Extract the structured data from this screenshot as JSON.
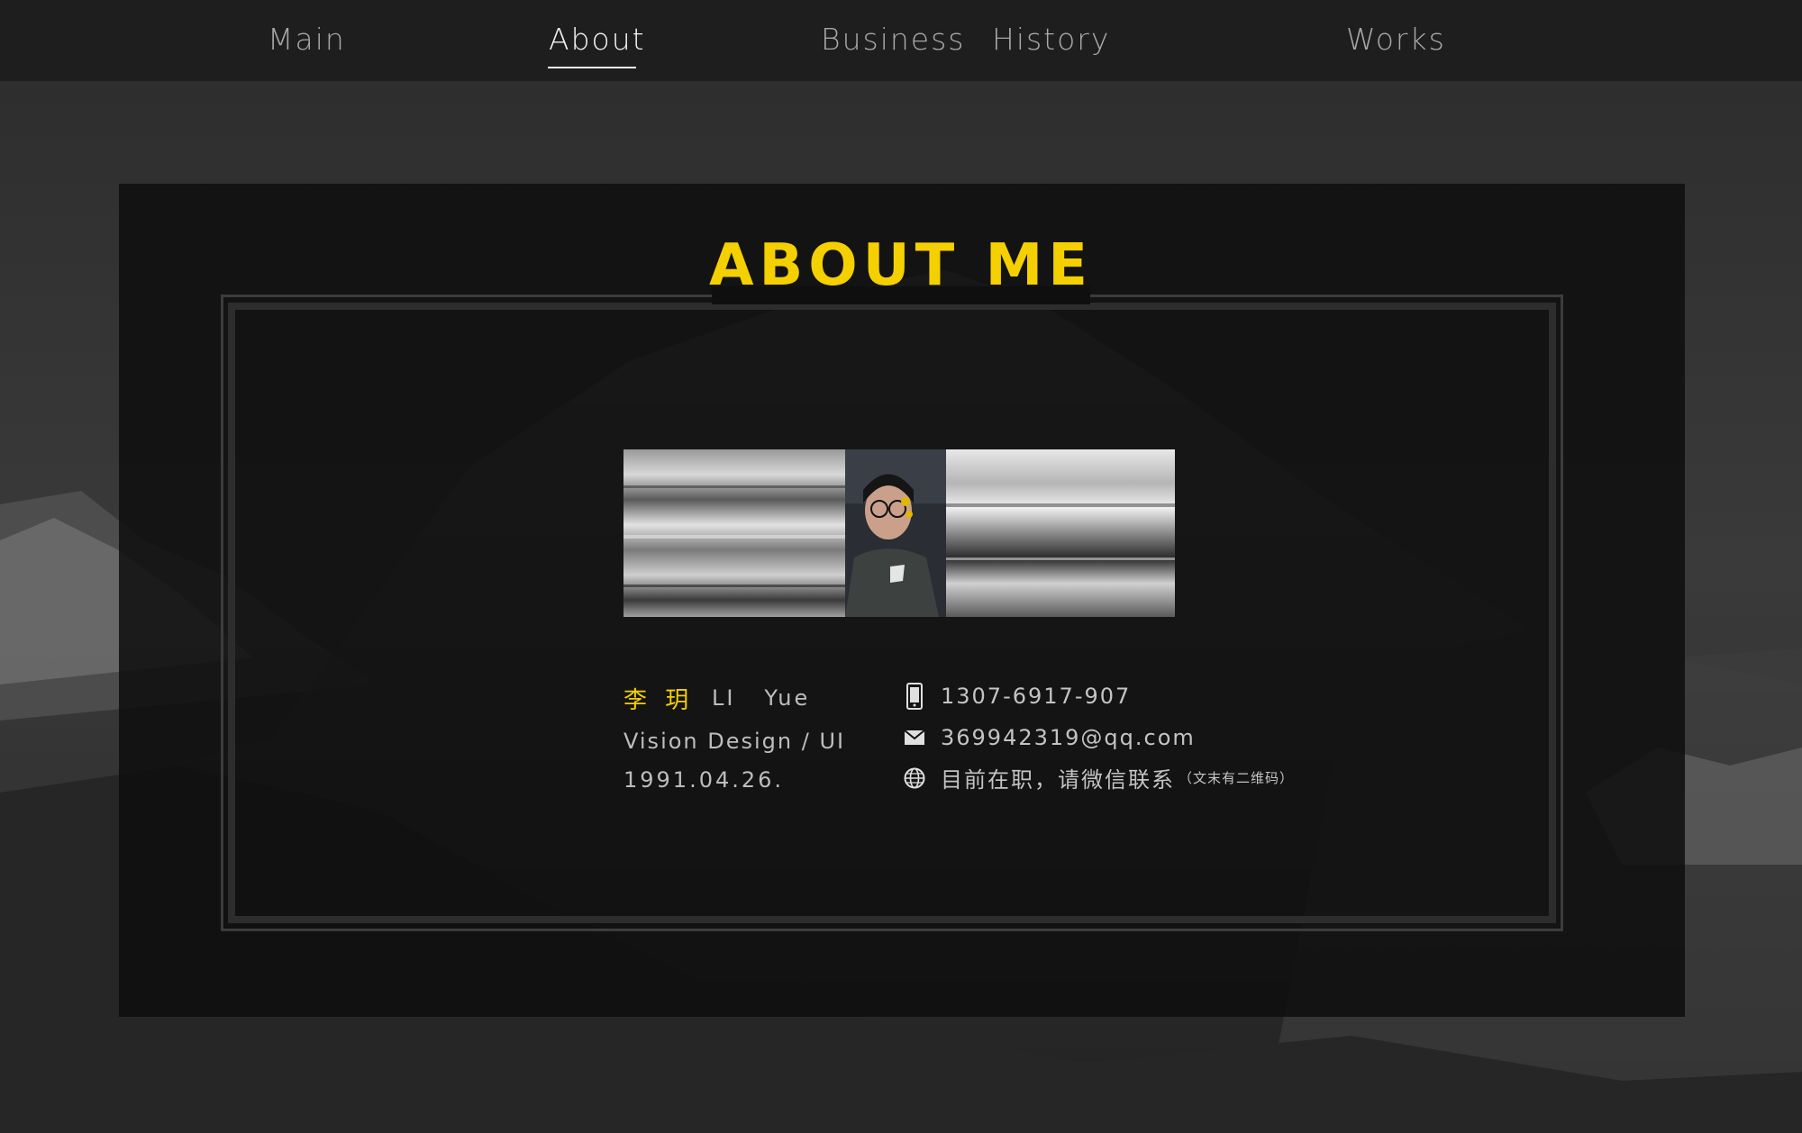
{
  "nav": {
    "items": [
      {
        "label": "Main"
      },
      {
        "label": "About"
      },
      {
        "label": "Business"
      },
      {
        "label": "History"
      },
      {
        "label": "Works"
      }
    ],
    "active": "About"
  },
  "about": {
    "title": "ABOUT ME",
    "name_cn": "李 玥",
    "name_en": "LI   Yue",
    "role": "Vision Design / UI",
    "dob": "1991.04.26."
  },
  "contact": {
    "phone": "1307-6917-907",
    "email": "369942319@qq.com",
    "status": "目前在职，请微信联系",
    "status_note": "（文末有二维码）"
  },
  "colors": {
    "accent": "#f5d000",
    "nav_bg": "#1e1e1e",
    "panel_bg": "#0e0e0e"
  },
  "icons": {
    "phone": "phone-icon",
    "email": "mail-icon",
    "web": "globe-icon"
  }
}
